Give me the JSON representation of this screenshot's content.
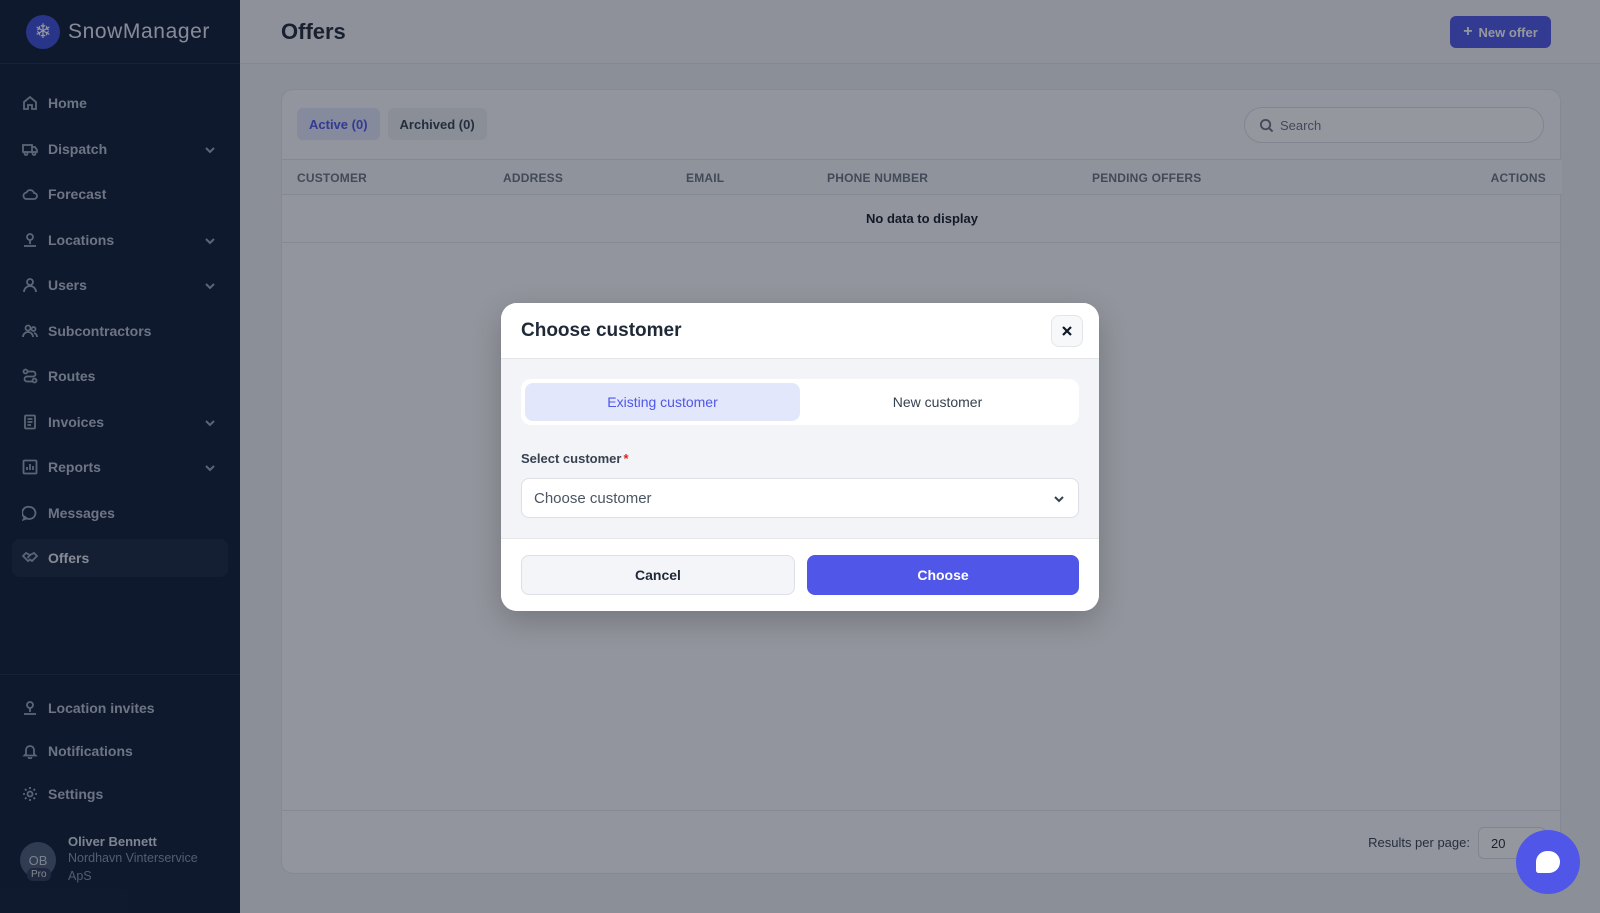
{
  "app": {
    "name": "SnowManager",
    "logo_icon": "snowflake-icon"
  },
  "sidebar": {
    "items": [
      {
        "label": "Home",
        "icon": "home-icon",
        "has_submenu": false
      },
      {
        "label": "Dispatch",
        "icon": "truck-icon",
        "has_submenu": true
      },
      {
        "label": "Forecast",
        "icon": "cloud-icon",
        "has_submenu": false
      },
      {
        "label": "Locations",
        "icon": "location-pin-icon",
        "has_submenu": true
      },
      {
        "label": "Users",
        "icon": "user-icon",
        "has_submenu": true
      },
      {
        "label": "Subcontractors",
        "icon": "users-icon",
        "has_submenu": false
      },
      {
        "label": "Routes",
        "icon": "route-icon",
        "has_submenu": false
      },
      {
        "label": "Invoices",
        "icon": "document-icon",
        "has_submenu": true
      },
      {
        "label": "Reports",
        "icon": "bar-chart-icon",
        "has_submenu": true
      },
      {
        "label": "Messages",
        "icon": "chat-icon",
        "has_submenu": false
      },
      {
        "label": "Offers",
        "icon": "handshake-icon",
        "has_submenu": false,
        "active": true
      }
    ],
    "bottom_items": [
      {
        "label": "Location invites",
        "icon": "location-pin-icon"
      },
      {
        "label": "Notifications",
        "icon": "bell-icon"
      },
      {
        "label": "Settings",
        "icon": "gear-icon"
      }
    ],
    "profile": {
      "initials": "OB",
      "badge": "Pro",
      "name": "Oliver Bennett",
      "company": "Nordhavn Vinterservice ApS"
    }
  },
  "header": {
    "title": "Offers",
    "new_offer_label": "New offer"
  },
  "tabs": [
    {
      "label": "Active (0)",
      "active": true
    },
    {
      "label": "Archived (0)",
      "active": false
    }
  ],
  "search": {
    "placeholder": "Search"
  },
  "table": {
    "columns": [
      "CUSTOMER",
      "ADDRESS",
      "EMAIL",
      "PHONE NUMBER",
      "PENDING OFFERS",
      "ACTIONS"
    ],
    "empty_text": "No data to display"
  },
  "pagination": {
    "results_label": "Results per page:",
    "per_page": "20"
  },
  "modal": {
    "title": "Choose customer",
    "segments": [
      {
        "label": "Existing customer",
        "active": true
      },
      {
        "label": "New customer",
        "active": false
      }
    ],
    "field_label": "Select customer",
    "required_mark": "*",
    "select_placeholder": "Choose customer",
    "cancel_label": "Cancel",
    "choose_label": "Choose"
  },
  "colors": {
    "accent": "#4f56e8",
    "sidebar_bg": "#0d1b33",
    "required": "#dc2626"
  }
}
